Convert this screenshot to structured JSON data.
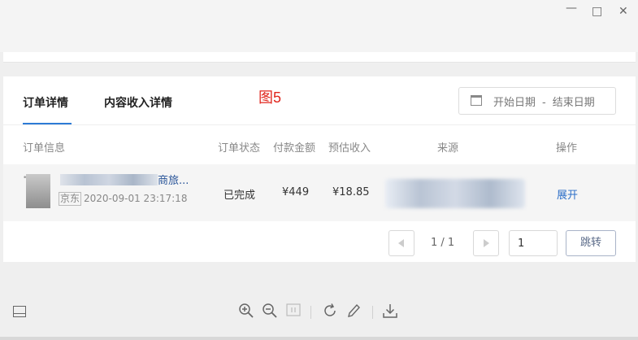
{
  "annotation": "图5",
  "tabs": [
    {
      "label": "订单详情",
      "active": true
    },
    {
      "label": "内容收入详情",
      "active": false
    }
  ],
  "date_range": {
    "start_placeholder": "开始日期",
    "separator": "-",
    "end_placeholder": "结束日期"
  },
  "table": {
    "headers": [
      "订单信息",
      "订单状态",
      "付款金额",
      "预估收入",
      "来源",
      "操作"
    ],
    "rows": [
      {
        "product_name": "商旅...",
        "shop": "京东",
        "time": "2020-09-01 23:17:18",
        "status": "已完成",
        "paid": "¥449",
        "income": "¥18.85",
        "action": "展开"
      }
    ]
  },
  "pager": {
    "count": "1 / 1",
    "page_value": "1",
    "jump_label": "跳转"
  },
  "colors": {
    "accent": "#2d7bd6",
    "annotation": "#e0261d",
    "link": "#2d6fc8"
  },
  "icons": [
    "minimize-icon",
    "maximize-icon",
    "close-icon",
    "calendar-icon",
    "panel-icon",
    "zoom-in-icon",
    "zoom-out-icon",
    "fit-page-icon",
    "rotate-icon",
    "pen-icon",
    "download-icon"
  ]
}
